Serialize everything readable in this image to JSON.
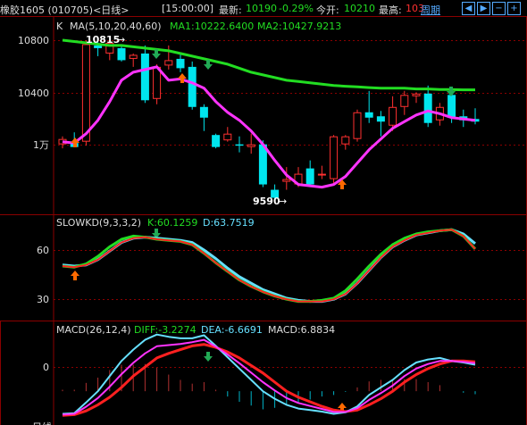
{
  "header": {
    "instrument": "橡胶1605 (010705)<日线>",
    "time": "[15:00:00]",
    "latest_label": "最新:",
    "latest_value": "10190",
    "change": "-0.29%",
    "open_label": "今开:",
    "open_value": "10210",
    "high_label": "最高:",
    "high_value": "103",
    "period_button": "周期"
  },
  "main_panel": {
    "indicator": "K",
    "ma_label": "MA(5,10,20,40,60)",
    "ma1": "MA1:10222.6400",
    "ma2": "MA2:10427.9213",
    "y_ticks": [
      "10800",
      "10400",
      "1万"
    ],
    "high_annotation": "10815",
    "low_annotation": "9590"
  },
  "kd_panel": {
    "label": "SLOWKD(9,3,3,2)",
    "k": "K:60.1259",
    "d": "D:63.7519",
    "y_ticks": [
      "60",
      "30"
    ]
  },
  "macd_panel": {
    "label": "MACD(26,12,4)",
    "diff": "DIFF:-3.2274",
    "dea": "DEA:-6.6691",
    "macd": "MACD:6.8834",
    "y_ticks": [
      "0"
    ],
    "bottom_label": "日线"
  },
  "colors": {
    "background": "#000000",
    "grid": "#8b0000",
    "up": "#ff3030",
    "down": "#00e5ee",
    "ma_long": "#22dd22",
    "ma_short": "#ff33ff",
    "text_green": "#22dd22",
    "text_blue": "#55aaff"
  },
  "chart_data": {
    "type": "candlestick",
    "candles": [
      {
        "o": 10020,
        "h": 10080,
        "l": 9990,
        "c": 10060
      },
      {
        "o": 10030,
        "h": 10110,
        "l": 10000,
        "c": 10000
      },
      {
        "o": 10040,
        "h": 10800,
        "l": 10010,
        "c": 10770
      },
      {
        "o": 10760,
        "h": 10815,
        "l": 10680,
        "c": 10740
      },
      {
        "o": 10700,
        "h": 10800,
        "l": 10650,
        "c": 10780
      },
      {
        "o": 10740,
        "h": 10760,
        "l": 10640,
        "c": 10650
      },
      {
        "o": 10660,
        "h": 10700,
        "l": 10600,
        "c": 10690
      },
      {
        "o": 10700,
        "h": 10760,
        "l": 10330,
        "c": 10350
      },
      {
        "o": 10360,
        "h": 10620,
        "l": 10320,
        "c": 10600
      },
      {
        "o": 10610,
        "h": 10760,
        "l": 10580,
        "c": 10650
      },
      {
        "o": 10660,
        "h": 10690,
        "l": 10560,
        "c": 10590
      },
      {
        "o": 10600,
        "h": 10640,
        "l": 10280,
        "c": 10300
      },
      {
        "o": 10300,
        "h": 10320,
        "l": 10120,
        "c": 10220
      },
      {
        "o": 10090,
        "h": 10100,
        "l": 9990,
        "c": 10000
      },
      {
        "o": 10050,
        "h": 10150,
        "l": 10040,
        "c": 10100
      },
      {
        "o": 10020,
        "h": 10080,
        "l": 9960,
        "c": 10010
      },
      {
        "o": 10000,
        "h": 10100,
        "l": 9950,
        "c": 10020
      },
      {
        "o": 10020,
        "h": 10050,
        "l": 9700,
        "c": 9720
      },
      {
        "o": 9680,
        "h": 9720,
        "l": 9590,
        "c": 9620
      },
      {
        "o": 9740,
        "h": 9850,
        "l": 9680,
        "c": 9760
      },
      {
        "o": 9720,
        "h": 9850,
        "l": 9700,
        "c": 9800
      },
      {
        "o": 9840,
        "h": 9900,
        "l": 9700,
        "c": 9720
      },
      {
        "o": 9790,
        "h": 9860,
        "l": 9760,
        "c": 9800
      },
      {
        "o": 9760,
        "h": 10090,
        "l": 9730,
        "c": 10080
      },
      {
        "o": 10020,
        "h": 10090,
        "l": 9980,
        "c": 10080
      },
      {
        "o": 10060,
        "h": 10280,
        "l": 10040,
        "c": 10260
      },
      {
        "o": 10260,
        "h": 10420,
        "l": 10180,
        "c": 10220
      },
      {
        "o": 10230,
        "h": 10270,
        "l": 10080,
        "c": 10190
      },
      {
        "o": 10160,
        "h": 10380,
        "l": 10120,
        "c": 10300
      },
      {
        "o": 10300,
        "h": 10420,
        "l": 10240,
        "c": 10390
      },
      {
        "o": 10380,
        "h": 10410,
        "l": 10330,
        "c": 10400
      },
      {
        "o": 10400,
        "h": 10460,
        "l": 10150,
        "c": 10180
      },
      {
        "o": 10200,
        "h": 10330,
        "l": 10160,
        "c": 10300
      },
      {
        "o": 10390,
        "h": 10440,
        "l": 10180,
        "c": 10220
      },
      {
        "o": 10230,
        "h": 10280,
        "l": 10150,
        "c": 10200
      },
      {
        "o": 10210,
        "h": 10290,
        "l": 10170,
        "c": 10190
      }
    ],
    "ma_short": [
      10040,
      10030,
      10100,
      10200,
      10340,
      10500,
      10560,
      10580,
      10600,
      10500,
      10510,
      10480,
      10440,
      10340,
      10260,
      10200,
      10120,
      10020,
      9900,
      9790,
      9720,
      9710,
      9700,
      9720,
      9780,
      9880,
      9980,
      10060,
      10140,
      10190,
      10240,
      10270,
      10250,
      10220,
      10210,
      10200
    ],
    "ma_long": [
      10800,
      10790,
      10780,
      10770,
      10760,
      10760,
      10750,
      10740,
      10730,
      10720,
      10700,
      10680,
      10660,
      10640,
      10620,
      10590,
      10560,
      10540,
      10520,
      10500,
      10490,
      10480,
      10470,
      10460,
      10455,
      10450,
      10445,
      10440,
      10440,
      10440,
      10435,
      10435,
      10430,
      10430,
      10428,
      10428
    ],
    "kd": {
      "k": [
        50,
        49,
        52,
        59,
        68,
        75,
        78,
        77,
        75,
        74,
        73,
        70,
        62,
        53,
        45,
        37,
        31,
        26,
        22,
        19,
        17,
        17,
        18,
        20,
        27,
        38,
        50,
        61,
        70,
        76,
        80,
        82,
        83,
        84,
        78,
        66
      ],
      "d": [
        51,
        50,
        51,
        56,
        64,
        72,
        76,
        77,
        76,
        75,
        74,
        72,
        65,
        57,
        48,
        40,
        34,
        28,
        24,
        20,
        18,
        17,
        17,
        19,
        24,
        34,
        46,
        58,
        68,
        74,
        79,
        81,
        83,
        84,
        80,
        71
      ]
    },
    "macd": {
      "diff": [
        -30,
        -29,
        -15,
        0,
        20,
        40,
        55,
        68,
        75,
        72,
        70,
        70,
        74,
        60,
        45,
        30,
        15,
        0,
        -10,
        -18,
        -23,
        -25,
        -27,
        -30,
        -28,
        -20,
        -5,
        5,
        15,
        28,
        38,
        42,
        44,
        40,
        38,
        35
      ],
      "dea": [
        -32,
        -31,
        -26,
        -18,
        -8,
        5,
        20,
        32,
        44,
        50,
        55,
        60,
        62,
        58,
        52,
        44,
        34,
        24,
        12,
        0,
        -8,
        -14,
        -20,
        -25,
        -27,
        -25,
        -18,
        -10,
        0,
        12,
        22,
        30,
        36,
        40,
        40,
        39
      ],
      "hist": [
        2,
        2,
        11,
        18,
        28,
        35,
        35,
        36,
        31,
        22,
        15,
        10,
        12,
        2,
        -7,
        -14,
        -19,
        -24,
        -22,
        -18,
        -15,
        -11,
        -7,
        -5,
        -1,
        5,
        13,
        15,
        15,
        16,
        16,
        12,
        8,
        0,
        -2,
        -4
      ]
    },
    "ylim_main": [
      9550,
      10900
    ],
    "ylim_kd": [
      0,
      95
    ],
    "ylim_macd": [
      -40,
      90
    ]
  }
}
